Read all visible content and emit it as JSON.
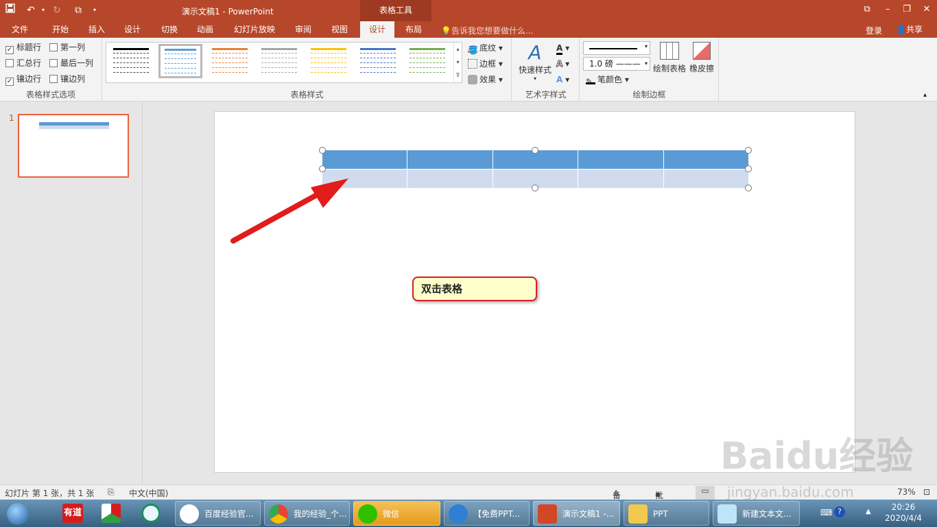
{
  "titlebar": {
    "title": "演示文稿1 - PowerPoint",
    "context_tab": "表格工具",
    "window_buttons": [
      "⧉",
      "–",
      "❐",
      "✕"
    ]
  },
  "tabs": [
    {
      "label": "文件"
    },
    {
      "label": "开始"
    },
    {
      "label": "插入"
    },
    {
      "label": "设计"
    },
    {
      "label": "切换"
    },
    {
      "label": "动画"
    },
    {
      "label": "幻灯片放映"
    },
    {
      "label": "审阅"
    },
    {
      "label": "视图"
    },
    {
      "label": "设计",
      "active": true
    },
    {
      "label": "布局"
    }
  ],
  "tell_me": "告诉我您想要做什么...",
  "login": "登录",
  "share": "共享",
  "table_style_options": {
    "label": "表格样式选项",
    "items": [
      {
        "label": "标题行",
        "checked": true
      },
      {
        "label": "第一列",
        "checked": false
      },
      {
        "label": "汇总行",
        "checked": false
      },
      {
        "label": "最后一列",
        "checked": false
      },
      {
        "label": "镶边行",
        "checked": true
      },
      {
        "label": "镶边列",
        "checked": false
      }
    ]
  },
  "table_styles": {
    "label": "表格样式",
    "colors": [
      "#000000",
      "#5b9bd5",
      "#ed7d31",
      "#a5a5a5",
      "#ffc000",
      "#4472c4",
      "#70ad47"
    ],
    "shading": "底纹",
    "borders": "边框",
    "effects": "效果"
  },
  "wordart": {
    "label": "艺术字样式",
    "quick_styles": "快速样式"
  },
  "draw_borders": {
    "label": "绘制边框",
    "pen_weight": "1.0 磅",
    "pen_color": "笔颜色",
    "draw_table": "绘制表格",
    "eraser": "橡皮擦"
  },
  "slides_pane": {
    "slide_number": "1"
  },
  "slide": {
    "callout_text": "双击表格",
    "table_header_color": "#5b9bd5",
    "table_band_color": "#d0dcee",
    "arrow_color": "#e21b1b"
  },
  "statusbar": {
    "slide_info": "幻灯片 第 1 张，共 1 张",
    "language": "中文(中国)",
    "notes": "备注",
    "comments": "批注",
    "zoom": "73%"
  },
  "taskbar": {
    "items": [
      {
        "label": "百度经验官..."
      },
      {
        "label": "我的经验_个..."
      },
      {
        "label": "微信"
      },
      {
        "label": "【免费PPT..."
      },
      {
        "label": "演示文稿1 -..."
      },
      {
        "label": "PPT"
      },
      {
        "label": "新建文本文..."
      }
    ],
    "time": "20:26",
    "date": "2020/4/4"
  },
  "watermark": {
    "brand": "Baidu经验",
    "url": "jingyan.baidu.com"
  }
}
